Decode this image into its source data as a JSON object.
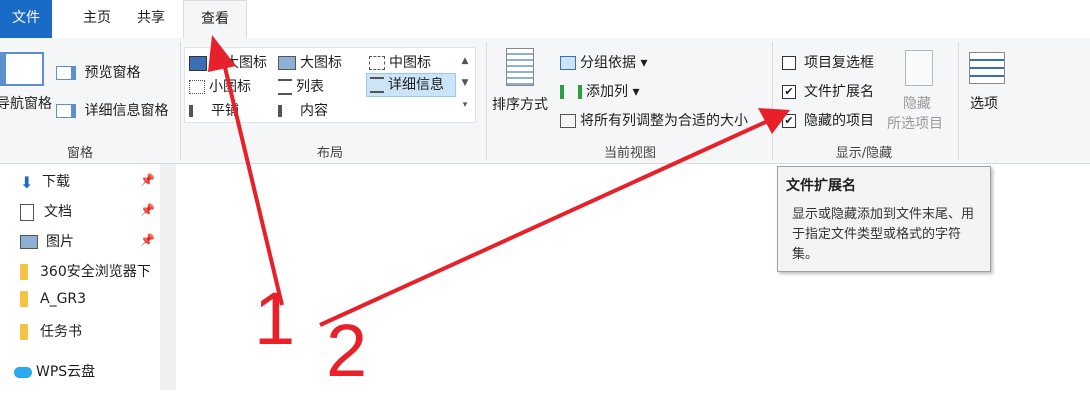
{
  "tabs": [
    {
      "label": "文件"
    },
    {
      "label": "主页"
    },
    {
      "label": "共享"
    },
    {
      "label": "查看"
    }
  ],
  "ribbon": {
    "panes": {
      "nav_pane": "导航窗格",
      "preview_pane": "预览窗格",
      "details_pane": "详细信息窗格",
      "group_label": "窗格"
    },
    "layout": {
      "items": [
        "超大图标",
        "大图标",
        "中图标",
        "小图标",
        "列表",
        "详细信息",
        "平铺",
        "内容"
      ],
      "group_label": "布局"
    },
    "current_view": {
      "sort_by": "排序方式",
      "group_by": "分组依据",
      "add_column": "添加列",
      "fit_columns": "将所有列调整为合适的大小",
      "group_label": "当前视图"
    },
    "show_hide": {
      "item_checkboxes": "项目复选框",
      "file_extensions": "文件扩展名",
      "hidden_items": "隐藏的项目",
      "hide_selected": "隐藏",
      "hide_selected_2": "所选项目",
      "group_label": "显示/隐藏"
    },
    "options": "选项"
  },
  "nav": {
    "items": [
      {
        "label": "下载"
      },
      {
        "label": "文档"
      },
      {
        "label": "图片"
      },
      {
        "label": "360安全浏览器下"
      },
      {
        "label": "A_GR3"
      },
      {
        "label": "任务书"
      },
      {
        "label": "WPS云盘"
      }
    ]
  },
  "tooltip": {
    "title": "文件扩展名",
    "body": "显示或隐藏添加到文件末尾、用于指定文件类型或格式的字符集。"
  },
  "annotations": {
    "one": "1",
    "two": "2"
  },
  "colors": {
    "accent": "#1a6bc6",
    "arrow": "#e8202a"
  }
}
